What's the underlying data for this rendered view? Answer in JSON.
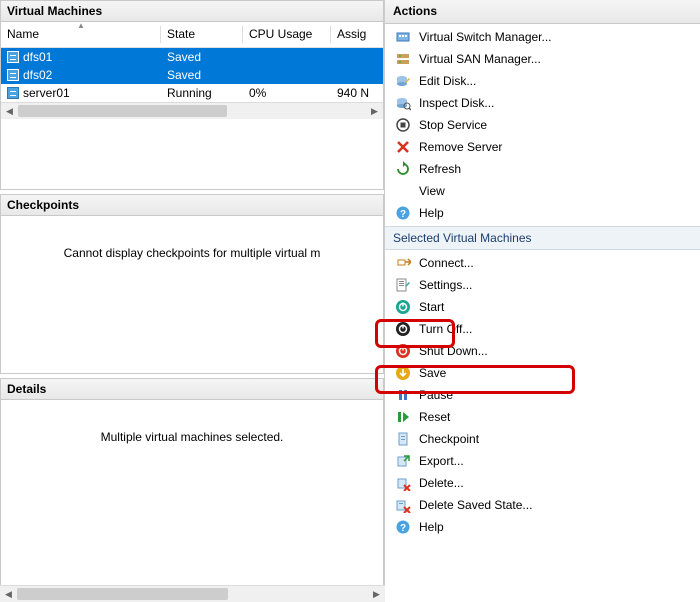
{
  "panels": {
    "vm": {
      "title": "Virtual Machines"
    },
    "checkpoints": {
      "title": "Checkpoints",
      "message": "Cannot display checkpoints for multiple virtual m"
    },
    "details": {
      "title": "Details",
      "message": "Multiple virtual machines selected."
    }
  },
  "vm_table": {
    "columns": {
      "name": "Name",
      "state": "State",
      "cpu": "CPU Usage",
      "assigned": "Assig"
    },
    "rows": [
      {
        "name": "dfs01",
        "state": "Saved",
        "cpu": "",
        "assigned": "",
        "selected": true
      },
      {
        "name": "dfs02",
        "state": "Saved",
        "cpu": "",
        "assigned": "",
        "selected": true
      },
      {
        "name": "server01",
        "state": "Running",
        "cpu": "0%",
        "assigned": "940 N",
        "selected": false
      }
    ]
  },
  "actions": {
    "header": "Actions",
    "global": [
      {
        "label": "Virtual Switch Manager...",
        "icon": "switch"
      },
      {
        "label": "Virtual SAN Manager...",
        "icon": "san"
      },
      {
        "label": "Edit Disk...",
        "icon": "disk-edit"
      },
      {
        "label": "Inspect Disk...",
        "icon": "disk-inspect"
      },
      {
        "label": "Stop Service",
        "icon": "stop"
      },
      {
        "label": "Remove Server",
        "icon": "remove"
      },
      {
        "label": "Refresh",
        "icon": "refresh"
      },
      {
        "label": "View",
        "icon": "blank"
      },
      {
        "label": "Help",
        "icon": "help"
      }
    ],
    "selected_header": "Selected Virtual Machines",
    "selected": [
      {
        "label": "Connect...",
        "icon": "connect"
      },
      {
        "label": "Settings...",
        "icon": "settings"
      },
      {
        "label": "Start",
        "icon": "start"
      },
      {
        "label": "Turn Off...",
        "icon": "turnoff"
      },
      {
        "label": "Shut Down...",
        "icon": "shutdown"
      },
      {
        "label": "Save",
        "icon": "save"
      },
      {
        "label": "Pause",
        "icon": "pause"
      },
      {
        "label": "Reset",
        "icon": "reset"
      },
      {
        "label": "Checkpoint",
        "icon": "checkpoint"
      },
      {
        "label": "Export...",
        "icon": "export"
      },
      {
        "label": "Delete...",
        "icon": "delete"
      },
      {
        "label": "Delete Saved State...",
        "icon": "delete-state"
      },
      {
        "label": "Help",
        "icon": "help"
      }
    ]
  }
}
